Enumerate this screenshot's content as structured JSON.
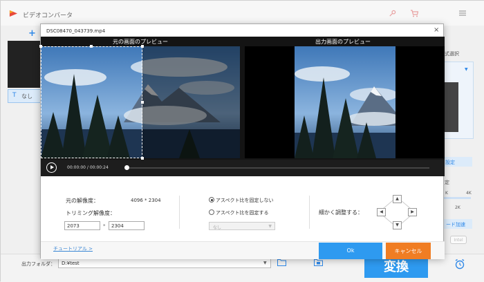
{
  "app": {
    "title": "ビデオコンバータ",
    "add_symbol": "+",
    "subtitle_button": "なし",
    "subtitle_icon": "T",
    "right_panel": {
      "format_select": "式選択",
      "format_arrow": "▼",
      "settings": "設定",
      "fixed": "定",
      "res_k": "K",
      "res_2k": "2K",
      "hw_accel": "ード加速",
      "intel": "Intel"
    },
    "output_folder_label": "出力フォルダ：",
    "output_folder_value": "D:¥test",
    "dropdown_glyph": "▼",
    "convert_label": "変換",
    "colors": {
      "accent": "#2e9af0",
      "cancel": "#f07d23",
      "link": "#3a86d4"
    }
  },
  "dialog": {
    "title": "DSC08470_043739.mp4",
    "close_glyph": "×",
    "original_preview_label": "元の画面のプレビュー",
    "output_preview_label": "出力画面のプレビュー",
    "time_current": "00:00:00",
    "time_separator": "/",
    "time_total": "00:00:24",
    "progress": 0,
    "original_resolution_label": "元の解像度：",
    "original_resolution_value": "4096 * 2304",
    "trim_resolution_label": "トリミング解像度：",
    "trim_width": "2073",
    "times_symbol": "*",
    "trim_height": "2304",
    "radio_unfixed": "アスペクト比を固定しない",
    "radio_fixed": "アスペクト比を固定する",
    "radio_selected": "unfixed",
    "ratio_select_value": "なし",
    "fine_adjust_label": "細かく調整する：",
    "arrows": {
      "up": "▲",
      "down": "▼",
      "left": "◀",
      "right": "▶"
    },
    "tutorial_link": "チュートリアル >",
    "ok_label": "Ok",
    "cancel_label": "キャンセル"
  }
}
